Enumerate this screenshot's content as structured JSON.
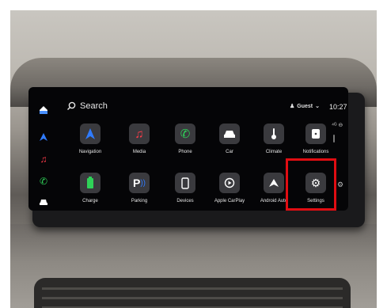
{
  "colors": {
    "highlight": "#e00d12",
    "screen_bg": "#050507",
    "tile": "#3a3a3e"
  },
  "search": {
    "label": "Search",
    "icon": "search-icon"
  },
  "header": {
    "user": "Guest",
    "time": "10:27"
  },
  "sidebar": [
    "home-icon",
    "navigation-icon",
    "media-icon",
    "phone-icon",
    "car-icon"
  ],
  "apps_row1": [
    {
      "label": "Navigation",
      "icon": "navigation-icon"
    },
    {
      "label": "Media",
      "icon": "music-icon"
    },
    {
      "label": "Phone",
      "icon": "phone-icon"
    },
    {
      "label": "Car",
      "icon": "car-icon"
    },
    {
      "label": "Climate",
      "icon": "thermometer-icon"
    },
    {
      "label": "Notifications",
      "icon": "notification-icon"
    }
  ],
  "apps_row2": [
    {
      "label": "Charge",
      "icon": "battery-icon"
    },
    {
      "label": "Parking",
      "icon": "parking-icon"
    },
    {
      "label": "Devices",
      "icon": "device-icon"
    },
    {
      "label": "Apple CarPlay",
      "icon": "carplay-icon"
    },
    {
      "label": "Android Auto",
      "icon": "android-auto-icon"
    },
    {
      "label": "Settings",
      "icon": "gear-icon"
    }
  ]
}
